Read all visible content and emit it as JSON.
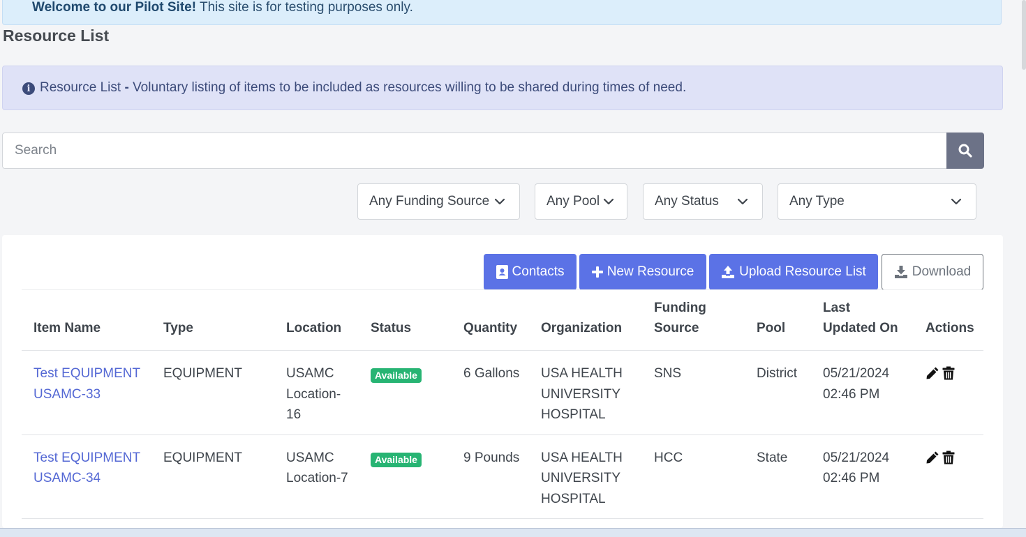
{
  "banner": {
    "strong": "Welcome to our Pilot Site!",
    "text": " This site is for testing purposes only."
  },
  "page": {
    "title": "Resource List"
  },
  "info": {
    "icon": "info-circle-icon",
    "title": "Resource List",
    "sep": " - ",
    "text": "Voluntary listing of items to be included as resources willing to be shared during times of need."
  },
  "search": {
    "placeholder": "Search",
    "value": "",
    "icon": "search-icon"
  },
  "filters": {
    "funding": "Any Funding Source",
    "pool": "Any Pool",
    "status": "Any Status",
    "type": "Any Type"
  },
  "buttons": {
    "contacts": "Contacts",
    "new_resource": "New Resource",
    "upload": "Upload Resource List",
    "download": "Download"
  },
  "table": {
    "headers": {
      "item_name": "Item Name",
      "type": "Type",
      "location": "Location",
      "status": "Status",
      "quantity": "Quantity",
      "organization": "Organization",
      "funding_source": "Funding Source",
      "pool": "Pool",
      "last_updated": "Last Updated On",
      "actions": "Actions"
    },
    "rows": [
      {
        "item_name": "Test EQUIPMENT USAMC-33",
        "type": "EQUIPMENT",
        "location": "USAMC Location-16",
        "status": "Available",
        "quantity": "6 Gallons",
        "organization": "USA HEALTH UNIVERSITY HOSPITAL",
        "funding_source": "SNS",
        "pool": "District",
        "last_updated": "05/21/2024 02:46 PM"
      },
      {
        "item_name": "Test EQUIPMENT USAMC-34",
        "type": "EQUIPMENT",
        "location": "USAMC Location-7",
        "status": "Available",
        "quantity": "9 Pounds",
        "organization": "USA HEALTH UNIVERSITY HOSPITAL",
        "funding_source": "HCC",
        "pool": "State",
        "last_updated": "05/21/2024 02:46 PM"
      }
    ]
  },
  "colors": {
    "primary": "#5b72e6",
    "success": "#27b473",
    "link": "#5468d4",
    "info_bg": "#dfe2f7"
  }
}
